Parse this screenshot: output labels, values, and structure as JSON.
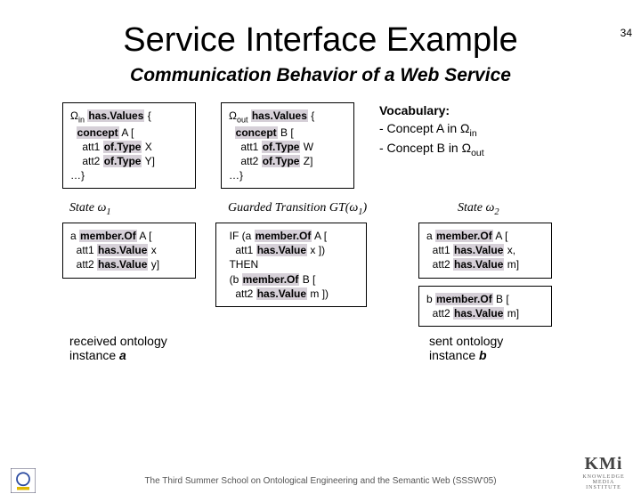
{
  "page_number": "34",
  "title": "Service Interface Example",
  "subtitle": "Communication Behavior of a Web Service",
  "omega_in": {
    "l1a": "Ω",
    "l1sub": "in",
    "l1b": " ",
    "l1hl": "has.Values",
    "l1c": " {",
    "l2a": "  ",
    "l2hl": "concept",
    "l2b": " A [",
    "l3a": "    att1 ",
    "l3hl": "of.Type",
    "l3b": " X",
    "l4a": "    att2 ",
    "l4hl": "of.Type",
    "l4b": " Y]",
    "l5": "…}"
  },
  "omega_out": {
    "l1a": "Ω",
    "l1sub": "out",
    "l1b": " ",
    "l1hl": "has.Values",
    "l1c": " {",
    "l2a": "  ",
    "l2hl": "concept",
    "l2b": " B [",
    "l3a": "    att1 ",
    "l3hl": "of.Type",
    "l3b": " W",
    "l4a": "    att2 ",
    "l4hl": "of.Type",
    "l4b": " Z]",
    "l5": "…}"
  },
  "vocab": {
    "l1": "Vocabulary:",
    "l2a": "- Concept A in Ω",
    "l2sub": "in",
    "l3a": "- Concept B in Ω",
    "l3sub": "out"
  },
  "states": {
    "s1a": "State ω",
    "s1sub": "1",
    "gta": "Guarded Transition GT(ω",
    "gtsub": "1",
    "gtb": ")",
    "s2a": "State ω",
    "s2sub": "2"
  },
  "mb1": {
    "l1a": "a ",
    "l1hl": "member.Of",
    "l1b": " A [",
    "l2a": "  att1 ",
    "l2hl": "has.Value",
    "l2b": " x",
    "l3a": "  att2 ",
    "l3hl": "has.Value",
    "l3b": " y]"
  },
  "gt": {
    "l1a": "  IF (a ",
    "l1hl": "member.Of",
    "l1b": " A [",
    "l2a": "    att1 ",
    "l2hl": "has.Value",
    "l2b": " x ])",
    "l3": "  THEN",
    "l4a": "  (b ",
    "l4hl": "member.Of",
    "l4b": " B [",
    "l5a": "    att2 ",
    "l5hl": "has.Value",
    "l5b": " m ])"
  },
  "mb2a": {
    "l1a": "a ",
    "l1hl": "member.Of",
    "l1b": " A [",
    "l2a": "  att1 ",
    "l2hl": "has.Value",
    "l2b": " x,",
    "l3a": "  att2 ",
    "l3hl": "has.Value",
    "l3b": " m]"
  },
  "mb2b": {
    "l1a": "b ",
    "l1hl": "member.Of",
    "l1b": " B [",
    "l2a": "  att2 ",
    "l2hl": "has.Value",
    "l2b": " m]"
  },
  "labels": {
    "recv1": "received ontology",
    "recv2a": "instance ",
    "recv2b": "a",
    "sent1": "sent ontology",
    "sent2a": "instance ",
    "sent2b": "b"
  },
  "footer": "The Third Summer School on Ontological Engineering and the Semantic Web (SSSW'05)"
}
